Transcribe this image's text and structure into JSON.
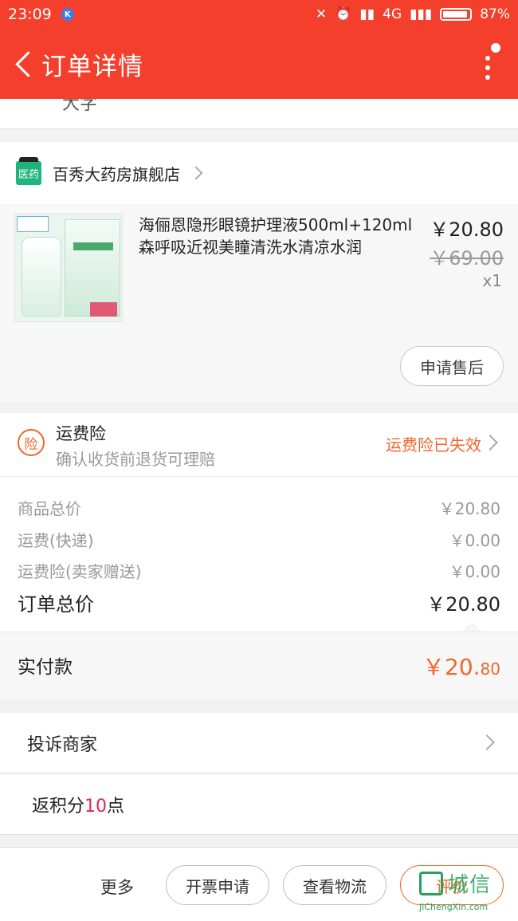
{
  "status_bar": {
    "time": "23:09",
    "k_badge": "K",
    "network": "4G",
    "battery": "87%"
  },
  "nav": {
    "title": "订单详情"
  },
  "top_remnant": {
    "text": "大字"
  },
  "shop": {
    "icon_text": "医药",
    "name": "百秀大药房旗舰店"
  },
  "product": {
    "name": "海俪恩隐形眼镜护理液500ml+120ml森呼吸近视美瞳清洗水清凉水润",
    "price": "￥20.80",
    "original_price": "￥69.00",
    "quantity": "x1",
    "after_sale_label": "申请售后"
  },
  "insurance": {
    "icon_text": "险",
    "title": "运费险",
    "subtitle": "确认收货前退货可理赔",
    "status": "运费险已失效"
  },
  "summary": {
    "rows": [
      {
        "label": "商品总价",
        "value": "￥20.80"
      },
      {
        "label": "运费(快递)",
        "value": "￥0.00"
      },
      {
        "label": "运费险(卖家赠送)",
        "value": "￥0.00"
      }
    ],
    "total_label": "订单总价",
    "total_value": "￥20.80"
  },
  "paid": {
    "label": "实付款",
    "amount_main": "￥20.",
    "amount_decimal": "80"
  },
  "actions": {
    "complain_label": "投诉商家",
    "points_prefix": "返积分",
    "points_value": "10",
    "points_suffix": "点"
  },
  "bottom_bar": {
    "more_label": "更多",
    "invoice_label": "开票申请",
    "logistics_label": "查看物流",
    "review_label": "评价"
  },
  "watermark": {
    "text": "城信",
    "sub": "JiChengXin.com"
  },
  "colors": {
    "brand_red": "#f33f2c",
    "accent_orange": "#f0662a",
    "points_red": "#e0284a"
  }
}
